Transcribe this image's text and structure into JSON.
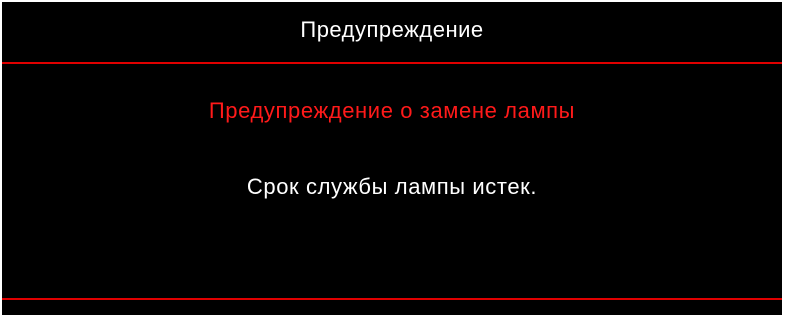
{
  "dialog": {
    "title": "Предупреждение",
    "warning_heading": "Предупреждение о замене лампы",
    "message": "Срок службы лампы истек."
  },
  "colors": {
    "background": "#000000",
    "title_text": "#ffffff",
    "heading_text": "#ff1a1a",
    "message_text": "#ffffff",
    "rule": "#e00000"
  }
}
